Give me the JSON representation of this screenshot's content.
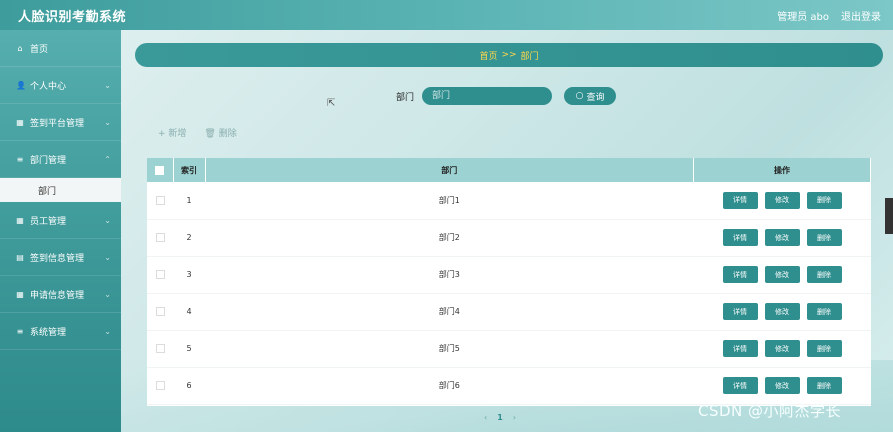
{
  "app": {
    "title": "人脸识别考勤系统"
  },
  "header": {
    "user_label": "管理员 abo",
    "logout_label": "退出登录"
  },
  "sidebar": {
    "items": [
      {
        "label": "首页",
        "icon": "home-icon",
        "glyph": "⌂"
      },
      {
        "label": "个人中心",
        "icon": "user-icon",
        "glyph": "👤"
      },
      {
        "label": "签到平台管理",
        "icon": "grid-icon",
        "glyph": "▦"
      },
      {
        "label": "部门管理",
        "icon": "list-icon",
        "glyph": "≡"
      },
      {
        "label": "员工管理",
        "icon": "grid-icon",
        "glyph": "▦"
      },
      {
        "label": "签到信息管理",
        "icon": "doc-icon",
        "glyph": "▤"
      },
      {
        "label": "申请信息管理",
        "icon": "grid-icon",
        "glyph": "▦"
      },
      {
        "label": "系统管理",
        "icon": "list-icon",
        "glyph": "≡"
      }
    ],
    "sub_item": "部门"
  },
  "breadcrumb": {
    "home": "首页",
    "sep": ">>",
    "current": "部门"
  },
  "search": {
    "label": "部门",
    "placeholder": "部门",
    "button": "查询"
  },
  "actions": {
    "add": "+ 新增",
    "delete": "🗑 删除"
  },
  "table": {
    "headers": {
      "index": "索引",
      "dept": "部门",
      "ops": "操作"
    },
    "rows": [
      {
        "index": "1",
        "dept": "部门1"
      },
      {
        "index": "2",
        "dept": "部门2"
      },
      {
        "index": "3",
        "dept": "部门3"
      },
      {
        "index": "4",
        "dept": "部门4"
      },
      {
        "index": "5",
        "dept": "部门5"
      },
      {
        "index": "6",
        "dept": "部门6"
      }
    ],
    "op_labels": {
      "detail": "详情",
      "edit": "修改",
      "delete": "删除"
    }
  },
  "pager": {
    "prev": "‹",
    "current": "1",
    "next": "›"
  },
  "watermark": "CSDN @小阿杰学长",
  "colors": {
    "accent": "#2f8e8e",
    "header": "#3e9c9c",
    "breadcrumb_text": "#ffd84a"
  }
}
